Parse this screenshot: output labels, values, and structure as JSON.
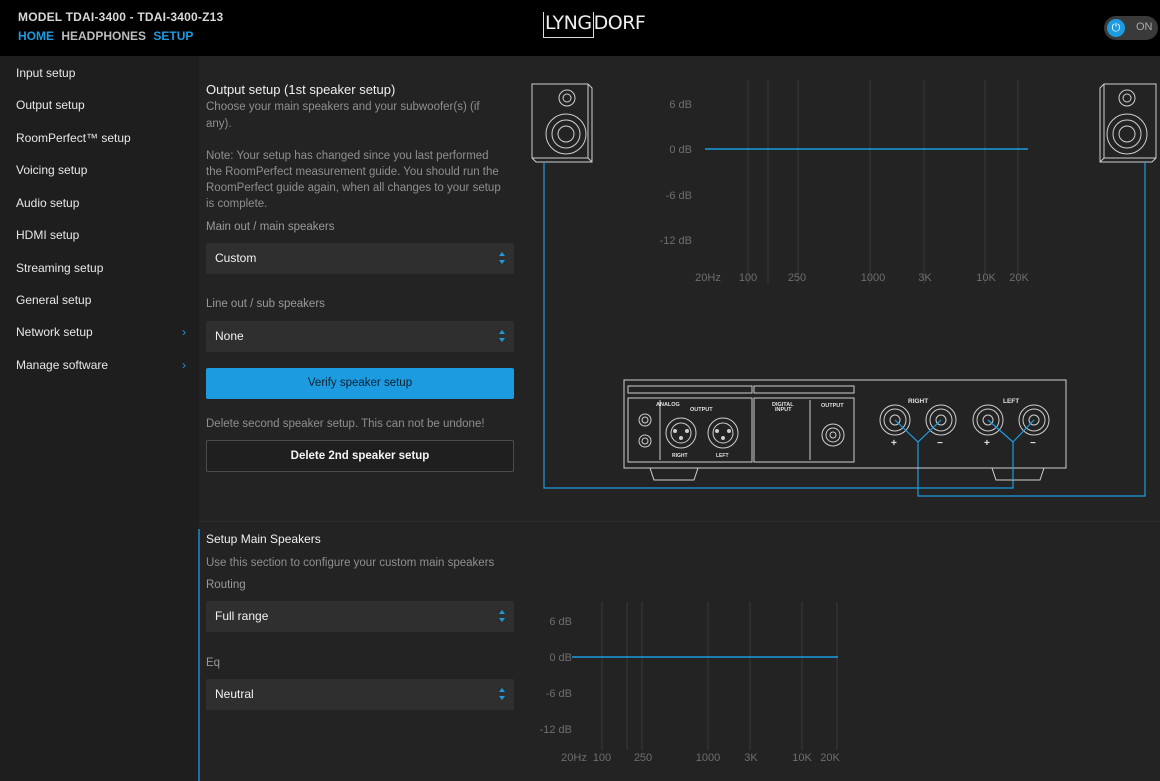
{
  "header": {
    "model": "MODEL TDAI-3400 - TDAI-3400-Z13",
    "nav": [
      "HOME",
      "HEADPHONES",
      "SETUP"
    ],
    "logo_part1": "LYNG",
    "logo_part2": "DORF",
    "power_label": "ON"
  },
  "sidebar": {
    "items": [
      {
        "label": "Input setup"
      },
      {
        "label": "Output setup"
      },
      {
        "label": "RoomPerfect™ setup"
      },
      {
        "label": "Voicing setup"
      },
      {
        "label": "Audio setup"
      },
      {
        "label": "HDMI setup"
      },
      {
        "label": "Streaming setup"
      },
      {
        "label": "General setup"
      },
      {
        "label": "Network setup",
        "chevron": "›"
      },
      {
        "label": "Manage software",
        "chevron": "›"
      }
    ]
  },
  "output": {
    "title": "Output setup (1st speaker setup)",
    "desc1": "Choose your main speakers and your subwoofer(s) (if",
    "desc2": "any).",
    "note1": "Note: Your setup has changed since you last performed",
    "note2": "the RoomPerfect measurement guide. You should run the",
    "note3": "RoomPerfect guide again, when all changes to your setup",
    "note4": "is complete.",
    "main_label": "Main out / main speakers",
    "main_value": "Custom",
    "line_label": "Line out / sub speakers",
    "line_value": "None",
    "verify_button": "Verify speaker setup",
    "delete_warning": "Delete second speaker setup. This can not be undone!",
    "delete_button": "Delete 2nd speaker setup"
  },
  "main_speakers": {
    "title": "Setup Main Speakers",
    "desc": "Use this section to configure your custom main speakers",
    "routing_label": "Routing",
    "routing_value": "Full range",
    "eq_label": "Eq",
    "eq_value": "Neutral"
  },
  "graph": {
    "db_labels": [
      "6 dB",
      "0 dB",
      "-6 dB",
      "-12 dB"
    ],
    "freq_labels": [
      "20Hz",
      "100",
      "250",
      "1000",
      "3K",
      "10K",
      "20K"
    ],
    "curve_db": 0
  },
  "amp_panel": {
    "analog": "ANALOG",
    "output": "OUTPUT",
    "right_small": "RIGHT",
    "left_small": "LEFT",
    "digital_input_1": "DIGITAL",
    "digital_input_2": "INPUT",
    "output2": "OUTPUT",
    "right": "RIGHT",
    "left": "LEFT",
    "plus": "+",
    "minus": "−"
  },
  "colors": {
    "accent": "#1d9be0",
    "background": "#232323",
    "sidebar": "#1e1e1e",
    "topbar": "#000000"
  }
}
